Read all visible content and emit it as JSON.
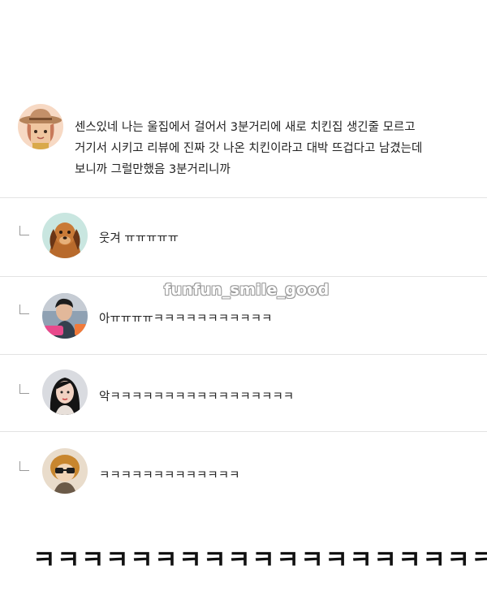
{
  "main_comment": {
    "lines": [
      "센스있네 나는 울집에서 걸어서 3분거리에 새로 치킨집 생긴줄 모르고",
      "거기서 시키고 리뷰에 진짜 갓 나온 치킨이라고 대박 뜨겁다고 남겼는데",
      "보니까 그럴만했음 3분거리니까"
    ]
  },
  "replies": [
    {
      "text": "웃겨 ㅠㅠㅠㅠㅠ"
    },
    {
      "text": "아ㅠㅠㅠㅠㅋㅋㅋㅋㅋㅋㅋㅋㅋㅋㅋ"
    },
    {
      "text": "악ㅋㅋㅋㅋㅋㅋㅋㅋㅋㅋㅋㅋㅋㅋㅋㅋㅋ"
    },
    {
      "text": "ㅋㅋㅋㅋㅋㅋㅋㅋㅋㅋㅋㅋㅋ"
    }
  ],
  "watermark": "funfun_smile_good",
  "bottom_caption": "ㅋㅋㅋㅋㅋㅋㅋㅋㅋㅋㅋㅋㅋㅋㅋㅋㅋㅋㅋ",
  "colors": {
    "divider": "#e3e3e3",
    "text": "#222222",
    "background": "#ffffff"
  }
}
